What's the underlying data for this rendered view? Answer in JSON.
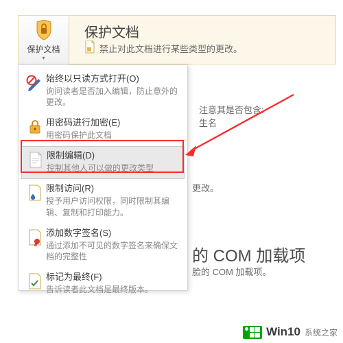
{
  "banner": {
    "button_label": "保护文档",
    "title": "保护文档",
    "desc": "禁止对此文档进行某些类型的更改。"
  },
  "menu": {
    "items": [
      {
        "title": "始终以只读方式打开(O)",
        "desc": "询问读者是否加入编辑，防止意外的更改。"
      },
      {
        "title": "用密码进行加密(E)",
        "desc": "用密码保护此文档"
      },
      {
        "title": "限制编辑(D)",
        "desc": "控制其他人可以做的更改类型"
      },
      {
        "title": "限制访问(R)",
        "desc": "授予用户访问权限，同时限制其编辑、复制和打印能力。"
      },
      {
        "title": "添加数字签名(S)",
        "desc": "通过添加不可见的数字签名来确保文档的完整性"
      },
      {
        "title": "标记为最终(F)",
        "desc": "告诉读者此文档是最终版本。"
      }
    ]
  },
  "background": {
    "line1": "注意其是否包含:",
    "line2": "生名",
    "line3": "更改。",
    "big": "的 COM 加载项",
    "line4": "脸的 COM 加载项。"
  },
  "watermark": {
    "brand": "Win10",
    "sub": "系统之家"
  }
}
